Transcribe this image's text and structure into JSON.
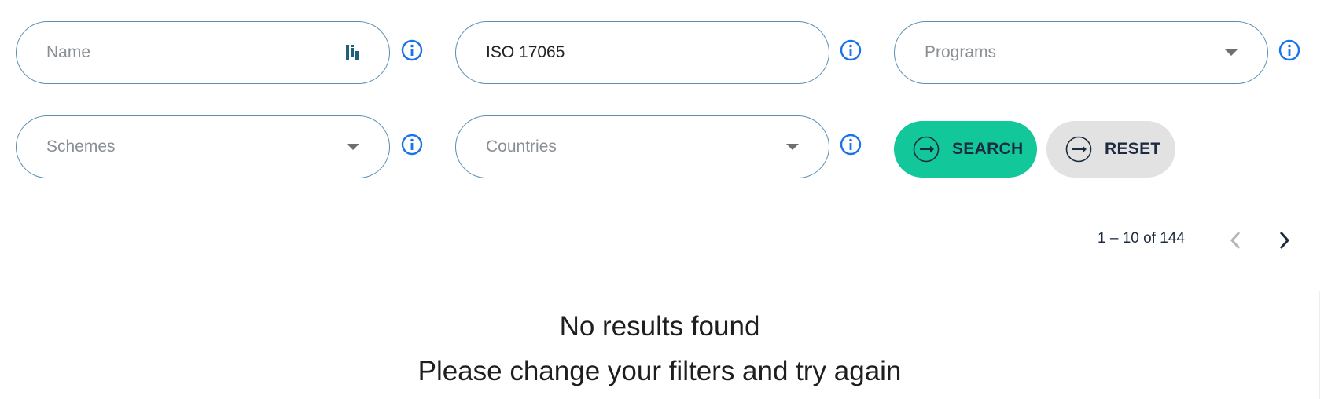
{
  "filters": {
    "name": {
      "placeholder": "Name",
      "value": ""
    },
    "standard": {
      "value": "ISO 17065"
    },
    "programs": {
      "placeholder": "Programs"
    },
    "schemes": {
      "placeholder": "Schemes"
    },
    "countries": {
      "placeholder": "Countries"
    }
  },
  "actions": {
    "search_label": "SEARCH",
    "reset_label": "RESET"
  },
  "pagination": {
    "range_text": "1 – 10 of 144"
  },
  "results": {
    "empty_title": "No results found",
    "empty_hint": "Please change your filters and try again"
  },
  "colors": {
    "accent": "#12c799",
    "info_icon": "#1a73e8",
    "field_border": "#5b8fb0",
    "text_dark": "#1c2b3f"
  }
}
